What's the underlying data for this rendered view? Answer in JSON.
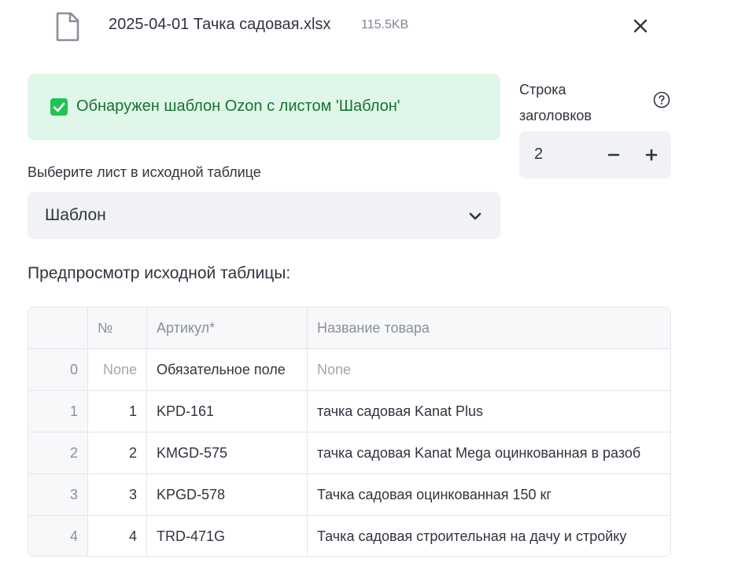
{
  "file": {
    "name": "2025-04-01 Тачка садовая.xlsx",
    "size": "115.5KB",
    "icon": "file-icon",
    "close_icon": "close-icon"
  },
  "alert": {
    "text": "Обнаружен шаблон Ozon с листом 'Шаблон'",
    "icon": "checkbox-checked-icon",
    "bg_color": "#dff6e8",
    "text_color": "#177233"
  },
  "header_row": {
    "label": "Строка заголовков",
    "value": "2",
    "minus_label": "−",
    "plus_label": "+",
    "help_icon": "help-circle-icon"
  },
  "sheet_select": {
    "label": "Выберите лист в исходной таблице",
    "value": "Шаблон",
    "icon": "chevron-down-icon"
  },
  "preview": {
    "title": "Предпросмотр исходной таблицы:",
    "columns": [
      "",
      "№",
      "Артикул*",
      "Название товара"
    ],
    "rows": [
      {
        "index": "0",
        "no": "None",
        "article": "Обязательное поле",
        "name": "None"
      },
      {
        "index": "1",
        "no": "1",
        "article": "KPD-161",
        "name": "тачка садовая Kanat Plus"
      },
      {
        "index": "2",
        "no": "2",
        "article": "KMGD-575",
        "name": "тачка садовая Kanat Mega оцинкованная в разоб"
      },
      {
        "index": "3",
        "no": "3",
        "article": "KPGD-578",
        "name": "Тачка садовая оцинкованная 150 кг"
      },
      {
        "index": "4",
        "no": "4",
        "article": "TRD-471G",
        "name": "Тачка садовая строительная на дачу и стройку"
      }
    ]
  }
}
